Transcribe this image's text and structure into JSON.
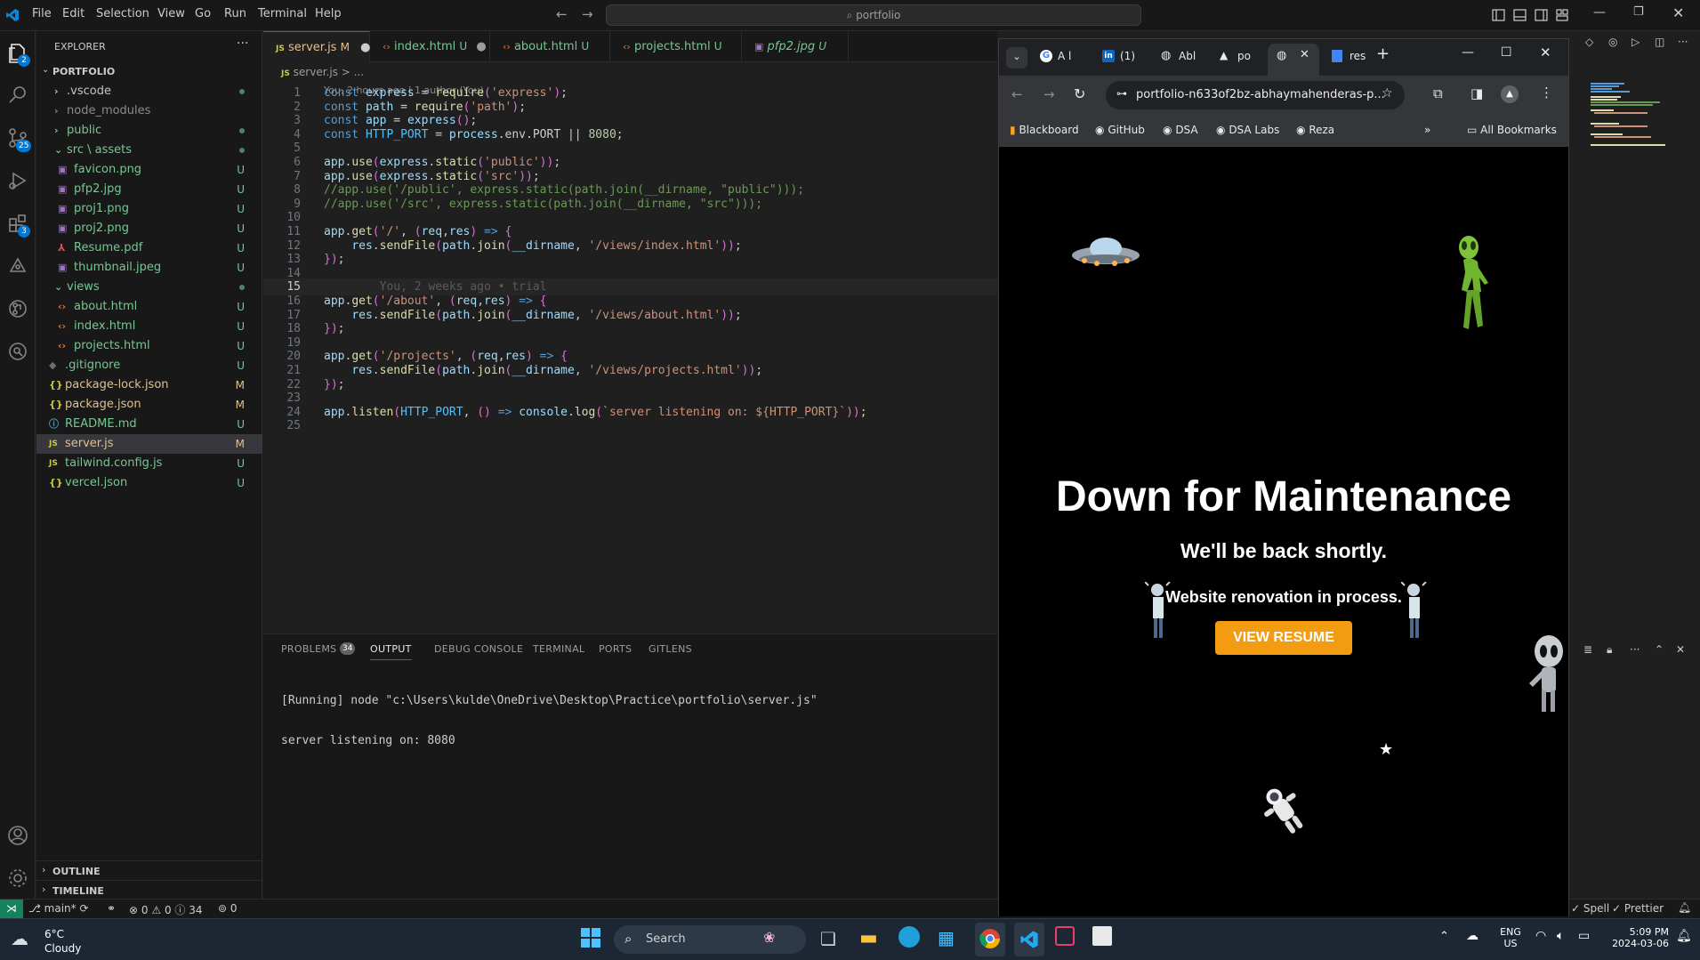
{
  "titlebar": {
    "menu": [
      "File",
      "Edit",
      "Selection",
      "View",
      "Go",
      "Run",
      "Terminal",
      "Help"
    ],
    "search": "portfolio"
  },
  "activity": {
    "explorer_badge": "2",
    "scm_badge": "25",
    "extensions_badge": "3"
  },
  "sidebar": {
    "title": "EXPLORER",
    "project": "PORTFOLIO",
    "items": [
      {
        "label": ".vscode",
        "status": ""
      },
      {
        "label": "node_modules",
        "status": ""
      },
      {
        "label": "public",
        "status": ""
      },
      {
        "label": "src \\ assets",
        "status": ""
      },
      {
        "label": "favicon.png",
        "status": "U"
      },
      {
        "label": "pfp2.jpg",
        "status": "U"
      },
      {
        "label": "proj1.png",
        "status": "U"
      },
      {
        "label": "proj2.png",
        "status": "U"
      },
      {
        "label": "Resume.pdf",
        "status": "U"
      },
      {
        "label": "thumbnail.jpeg",
        "status": "U"
      },
      {
        "label": "views",
        "status": ""
      },
      {
        "label": "about.html",
        "status": "U"
      },
      {
        "label": "index.html",
        "status": "U"
      },
      {
        "label": "projects.html",
        "status": "U"
      },
      {
        "label": ".gitignore",
        "status": "U"
      },
      {
        "label": "package-lock.json",
        "status": "M"
      },
      {
        "label": "package.json",
        "status": "M"
      },
      {
        "label": "README.md",
        "status": "U"
      },
      {
        "label": "server.js",
        "status": "M"
      },
      {
        "label": "tailwind.config.js",
        "status": "U"
      },
      {
        "label": "vercel.json",
        "status": "U"
      }
    ],
    "outline": "OUTLINE",
    "timeline": "TIMELINE"
  },
  "tabs": [
    {
      "label": "server.js",
      "status": "M"
    },
    {
      "label": "index.html",
      "status": "U"
    },
    {
      "label": "about.html",
      "status": "U"
    },
    {
      "label": "projects.html",
      "status": "U"
    },
    {
      "label": "pfp2.jpg",
      "status": "U"
    }
  ],
  "breadcrumb": "server.js > ...",
  "blame_header": "You, 2 hours ago | 1 author (You)",
  "code_lines": [
    "const express = require('express');",
    "const path = require('path');",
    "const app = express();",
    "const HTTP_PORT = process.env.PORT || 8080;",
    "",
    "app.use(express.static('public'));",
    "app.use(express.static('src'));",
    "//app.use('/public', express.static(path.join(__dirname, \"public\")));",
    "//app.use('/src', express.static(path.join(__dirname, \"src\")));",
    "",
    "app.get('/', (req,res) => {",
    "    res.sendFile(path.join(__dirname, '/views/index.html'));",
    "});",
    "",
    "        You, 2 weeks ago • trial",
    "app.get('/about', (req,res) => {",
    "    res.sendFile(path.join(__dirname, '/views/about.html'));",
    "});",
    "",
    "app.get('/projects', (req,res) => {",
    "    res.sendFile(path.join(__dirname, '/views/projects.html'));",
    "});",
    "",
    "app.listen(HTTP_PORT, () => console.log(`server listening on: ${HTTP_PORT}`));",
    ""
  ],
  "panel": {
    "tabs": [
      "PROBLEMS",
      "OUTPUT",
      "DEBUG CONSOLE",
      "TERMINAL",
      "PORTS",
      "GITLENS"
    ],
    "problems_count": "34",
    "output_lines": [
      "[Running] node \"c:\\Users\\kulde\\OneDrive\\Desktop\\Practice\\portfolio\\server.js\"",
      "server listening on: 8080"
    ]
  },
  "statusbar": {
    "branch": "main*",
    "errors": "0",
    "warnings": "0",
    "infos": "34",
    "ports": "0",
    "spell": "Spell",
    "prettier": "Prettier"
  },
  "browser": {
    "tabs": [
      "A l",
      "(1)",
      "Abl",
      "po",
      "",
      "res"
    ],
    "url": "portfolio-n633of2bz-abhaymahenderas-p...",
    "bookmarks": [
      "Blackboard",
      "GitHub",
      "DSA",
      "DSA Labs",
      "Reza"
    ],
    "all_bookmarks": "All Bookmarks",
    "page": {
      "heading": "Down for Maintenance",
      "subheading": "We'll be back shortly.",
      "note": "Website renovation in process.",
      "button": "VIEW RESUME"
    }
  },
  "taskbar": {
    "weather_temp": "6°C",
    "weather_desc": "Cloudy",
    "search": "Search",
    "lang": "ENG",
    "region": "US",
    "time": "5:09 PM",
    "date": "2024-03-06"
  }
}
